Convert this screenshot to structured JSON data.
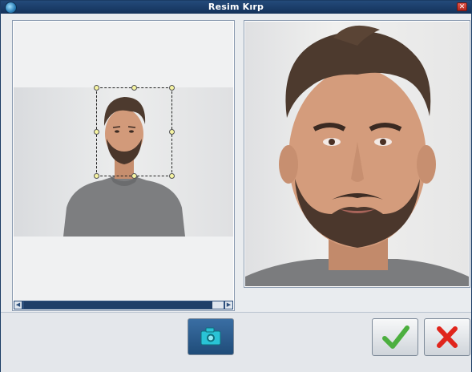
{
  "window": {
    "title": "Resim Kırp",
    "icons": {
      "app": "app-logo-icon",
      "close": "close-icon"
    },
    "close_glyph": "✕"
  },
  "left_panel": {
    "scrollbar": {
      "left_arrow": "◀",
      "right_arrow": "▶"
    },
    "crop_selection": {
      "handle_color": "#f6f4a2",
      "border_color": "#222222"
    }
  },
  "buttons": {
    "camera": {
      "icon": "camera-icon",
      "color": "#2a5a8a"
    },
    "ok": {
      "icon": "checkmark-icon",
      "color": "#4caf3f"
    },
    "cancel": {
      "icon": "x-icon",
      "color": "#e0251c"
    }
  },
  "colors": {
    "title_bar": "#1e4270",
    "scrollbar": "#2c4f7c",
    "background": "#e9ecef"
  }
}
